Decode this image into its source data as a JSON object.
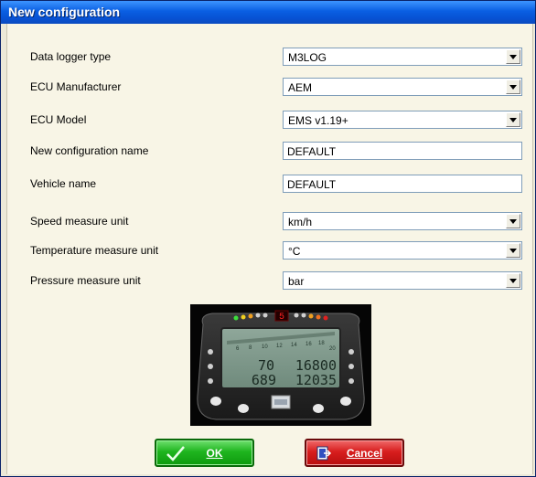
{
  "window": {
    "title": "New configuration"
  },
  "form": {
    "data_logger_type": {
      "label": "Data logger type",
      "value": "M3LOG"
    },
    "ecu_manufacturer": {
      "label": "ECU Manufacturer",
      "value": "AEM"
    },
    "ecu_model": {
      "label": "ECU Model",
      "value": "EMS v1.19+"
    },
    "configuration_name": {
      "label": "New configuration name",
      "value": "DEFAULT"
    },
    "vehicle_name": {
      "label": "Vehicle name",
      "value": "DEFAULT"
    },
    "speed_unit": {
      "label": "Speed measure unit",
      "value": "km/h"
    },
    "temperature_unit": {
      "label": "Temperature measure unit",
      "value": "°C"
    },
    "pressure_unit": {
      "label": "Pressure measure unit",
      "value": "bar"
    }
  },
  "device": {
    "gear": "5",
    "speed": "70",
    "rpm": "16800",
    "odometer_left": "689",
    "odometer_right": "12035",
    "scale_labels": [
      "6",
      "8",
      "10",
      "12",
      "14",
      "16",
      "18",
      "20"
    ]
  },
  "buttons": {
    "ok_label": "OK",
    "cancel_label": "Cancel"
  },
  "colors": {
    "titlebar": "#0a5fe2",
    "ok_button": "#1fb51f",
    "cancel_button": "#d81e1e",
    "dialog_background": "#f8f5e6"
  },
  "icons": {
    "ok": "checkmark-icon",
    "cancel": "exit-door-icon",
    "dropdown": "chevron-down-icon"
  }
}
